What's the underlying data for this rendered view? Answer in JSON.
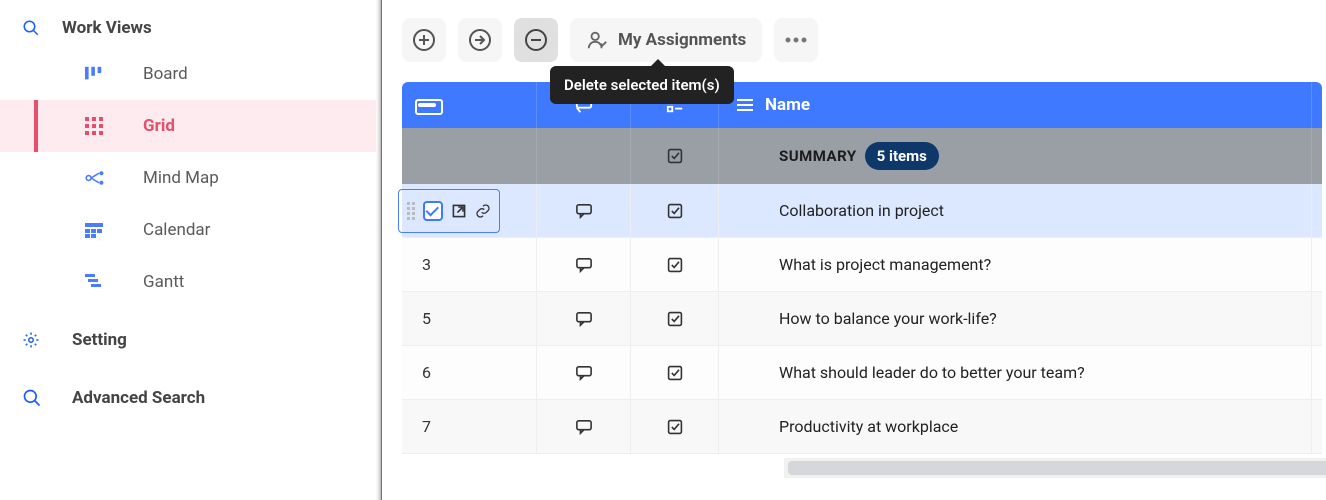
{
  "sidebar": {
    "header": "Work Views",
    "items": [
      {
        "label": "Board"
      },
      {
        "label": "Grid"
      },
      {
        "label": "Mind Map"
      },
      {
        "label": "Calendar"
      },
      {
        "label": "Gantt"
      }
    ],
    "setting_label": "Setting",
    "advanced_search_label": "Advanced Search"
  },
  "toolbar": {
    "assignments_label": "My Assignments",
    "tooltip_delete": "Delete selected item(s)"
  },
  "grid": {
    "columns": {
      "name": "Name"
    },
    "summary": {
      "label": "SUMMARY",
      "count_text": "5 items"
    },
    "rows": [
      {
        "num": "",
        "name": "Collaboration in project"
      },
      {
        "num": "3",
        "name": "What is project management?"
      },
      {
        "num": "5",
        "name": "How to balance your work-life?"
      },
      {
        "num": "6",
        "name": "What should leader do to better your team?"
      },
      {
        "num": "7",
        "name": "Productivity at workplace"
      }
    ]
  }
}
